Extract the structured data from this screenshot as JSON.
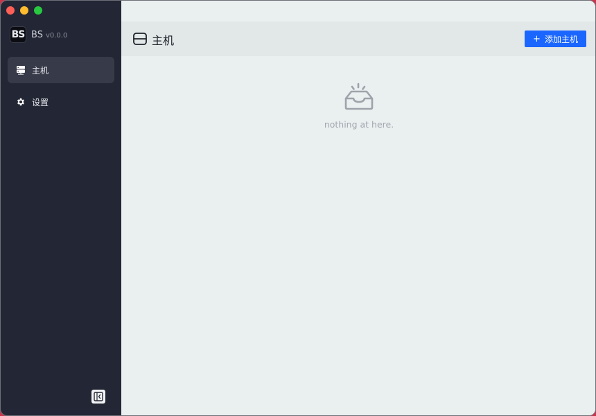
{
  "app": {
    "name": "BS",
    "version": "v0.0.0",
    "logo_text": "BS"
  },
  "sidebar": {
    "items": [
      {
        "label": "主机",
        "icon": "server-icon",
        "active": true
      },
      {
        "label": "设置",
        "icon": "gear-icon",
        "active": false
      }
    ]
  },
  "header": {
    "title": "主机",
    "add_button": {
      "plus": "+",
      "label": "添加主机"
    }
  },
  "empty_state": {
    "text": "nothing at here."
  },
  "colors": {
    "sidebar_bg": "#232634",
    "active_item_bg": "#373a49",
    "main_bg": "#eaefef",
    "header_bg": "#e2e7e7",
    "primary": "#1a66ff"
  }
}
